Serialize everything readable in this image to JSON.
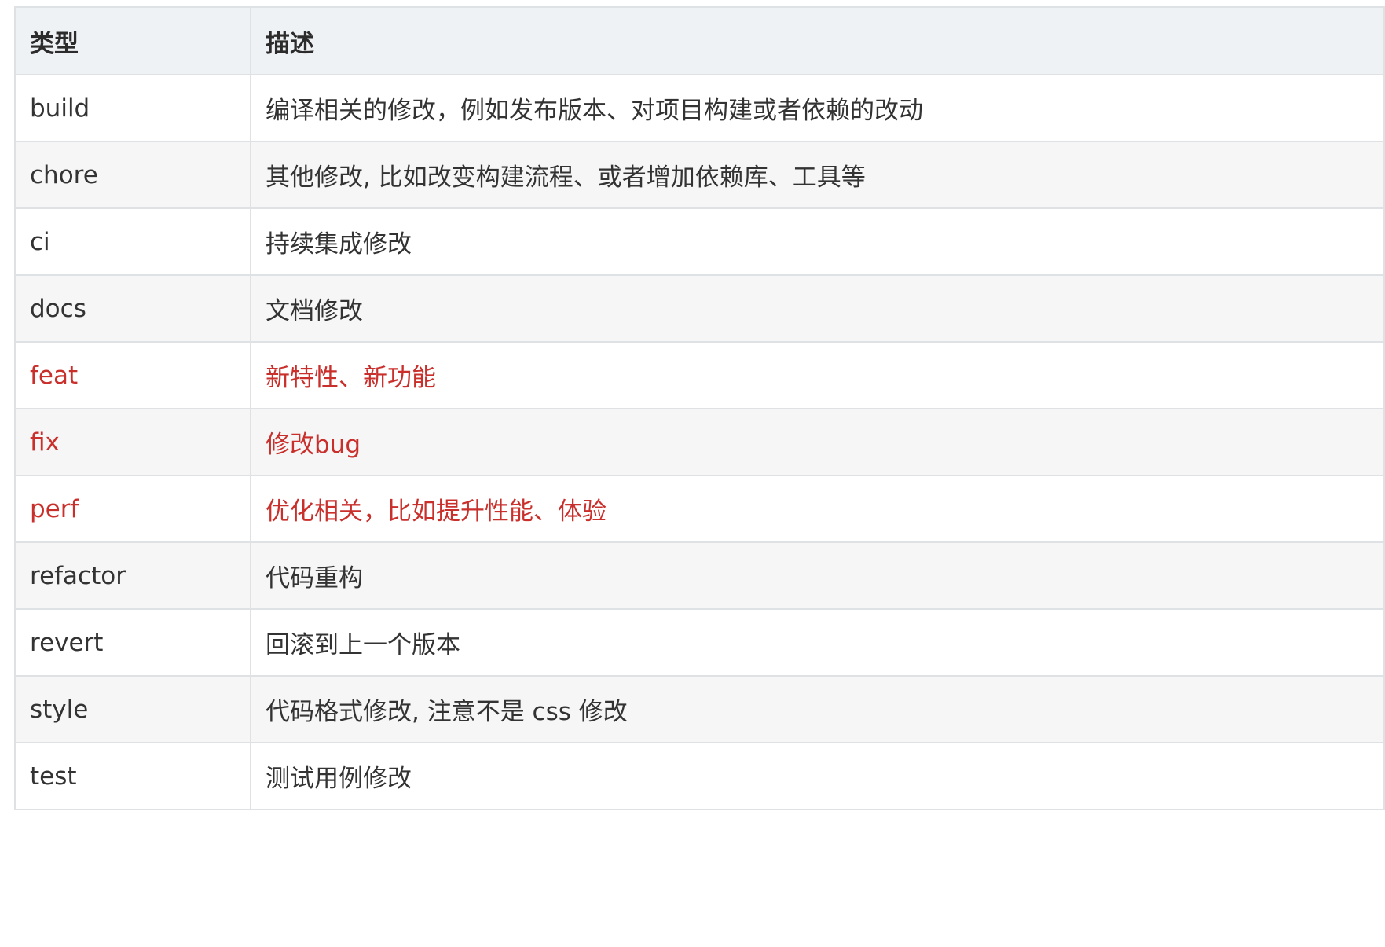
{
  "table": {
    "headers": [
      "类型",
      "描述"
    ],
    "highlight_color": "#c9302c",
    "rows": [
      {
        "type": "build",
        "desc": "编译相关的修改，例如发布版本、对项目构建或者依赖的改动",
        "highlight": false
      },
      {
        "type": "chore",
        "desc": "其他修改, 比如改变构建流程、或者增加依赖库、工具等",
        "highlight": false
      },
      {
        "type": "ci",
        "desc": "持续集成修改",
        "highlight": false
      },
      {
        "type": "docs",
        "desc": "文档修改",
        "highlight": false
      },
      {
        "type": "feat",
        "desc": "新特性、新功能",
        "highlight": true
      },
      {
        "type": "fix",
        "desc": "修改bug",
        "highlight": true
      },
      {
        "type": "perf",
        "desc": "优化相关，比如提升性能、体验",
        "highlight": true
      },
      {
        "type": "refactor",
        "desc": "代码重构",
        "highlight": false
      },
      {
        "type": "revert",
        "desc": "回滚到上一个版本",
        "highlight": false
      },
      {
        "type": "style",
        "desc": "代码格式修改, 注意不是 css 修改",
        "highlight": false
      },
      {
        "type": "test",
        "desc": "测试用例修改",
        "highlight": false
      }
    ]
  }
}
